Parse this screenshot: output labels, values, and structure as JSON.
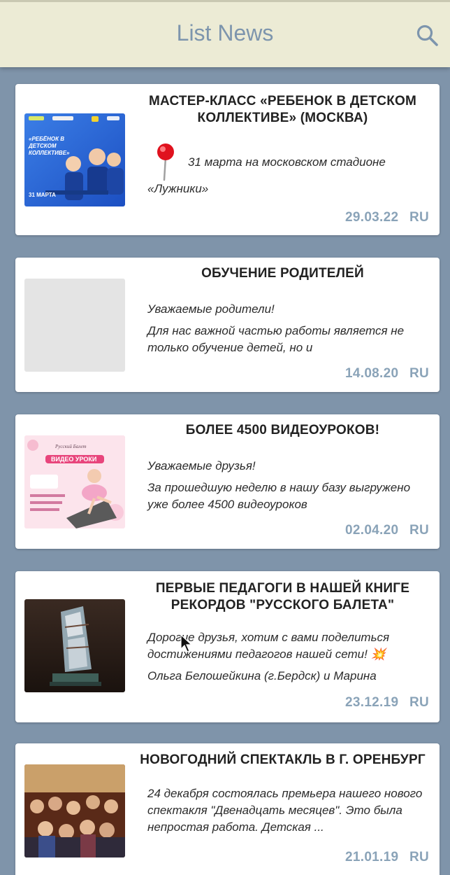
{
  "header": {
    "title": "List News",
    "search_icon": "search-icon"
  },
  "news": [
    {
      "title": "МАСТЕР-КЛАСС «РЕБЕНОК В ДЕТСКОМ КОЛЛЕКТИВЕ» (МОСКВА)",
      "pin_line": "31 марта на московском стадионе",
      "pin_line_2": "«Лужники»",
      "date": "29.03.22",
      "lang": "RU",
      "thumb_text": "«РЕБЁНОК В ДЕТСКОМ КОЛЛЕКТИВЕ»",
      "thumb_date": "31 МАРТА"
    },
    {
      "title": "ОБУЧЕНИЕ РОДИТЕЛЕЙ",
      "text_1": "Уважаемые родители!",
      "text_2": "Для нас важной частью работы является не только обучение детей, но и",
      "date": "14.08.20",
      "lang": "RU"
    },
    {
      "title": "БОЛЕЕ 4500 ВИДЕОУРОКОВ!",
      "text_1": "Уважаемые друзья!",
      "text_2": "За прошедшую неделю в нашу базу выгружено уже более 4500 видеоуроков",
      "date": "02.04.20",
      "lang": "RU",
      "thumb_brand": "Русский Балет",
      "thumb_text": "ВИДЕО УРОКИ"
    },
    {
      "title": "ПЕРВЫЕ ПЕДАГОГИ В НАШЕЙ КНИГЕ РЕКОРДОВ \"РУССКОГО БАЛЕТА\"",
      "text_1": "Дорогие друзья, хотим с вами поделиться достижениями педагогов нашей сети! 💥",
      "text_2": "Ольга Белошейкина (г.Бердск) и Марина",
      "date": "23.12.19",
      "lang": "RU"
    },
    {
      "title": "НОВОГОДНИЙ СПЕКТАКЛЬ В Г. ОРЕНБУРГ",
      "text_1": "24 декабря состоялась премьера нашего нового спектакля \"Двенадцать месяцев\". Это была непростая работа. Детская ...",
      "date": "21.01.19",
      "lang": "RU"
    }
  ],
  "colors": {
    "background": "#7f94aa",
    "app_bar": "#ecebd5",
    "title": "#7d95ad",
    "meta": "#8aa3b8"
  }
}
